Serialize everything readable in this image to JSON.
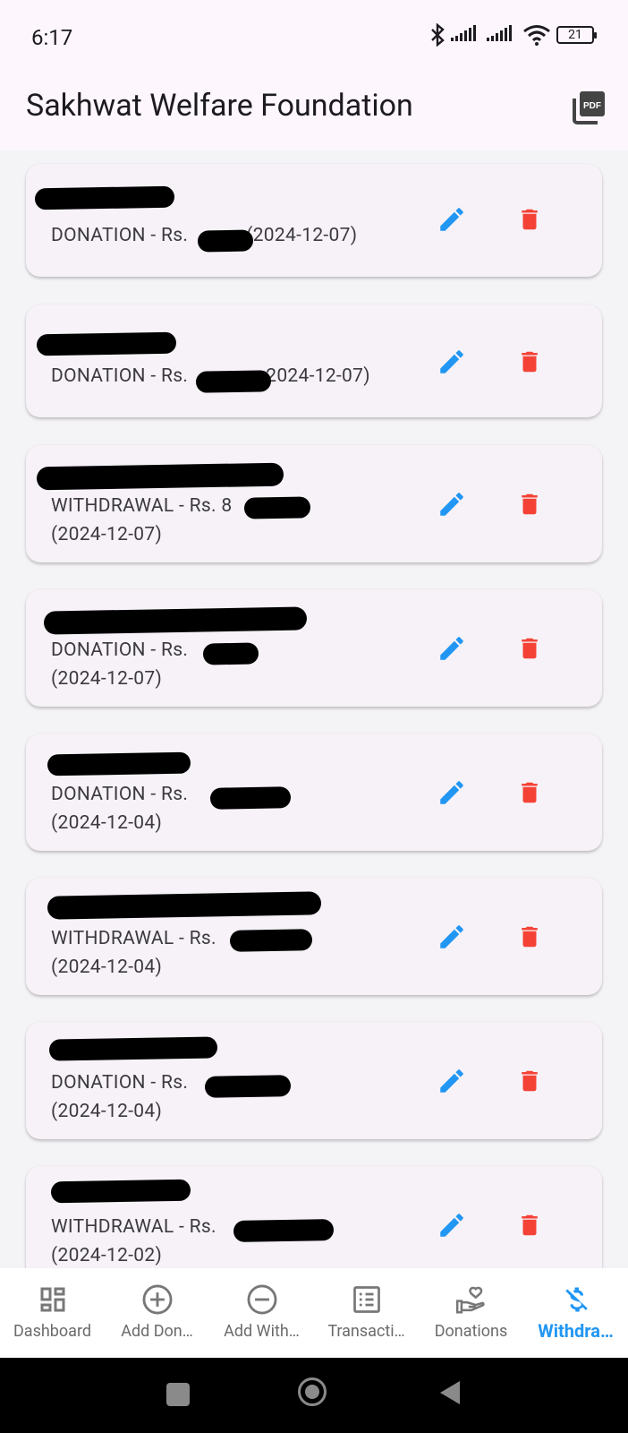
{
  "status": {
    "time": "6:17",
    "battery": "21"
  },
  "app_bar": {
    "title": "Sakhwat Welfare Foundation",
    "pdf_icon": "pdf-export-icon"
  },
  "colors": {
    "edit": "#2196f3",
    "delete": "#f44336",
    "active_tab": "#2196f3"
  },
  "transactions": [
    {
      "name": "",
      "line1": "DONATION - Rs.",
      "line2": "(2024-12-07)",
      "wrapped": false
    },
    {
      "name": "",
      "line1": "DONATION - Rs.",
      "line2": "2024-12-07)",
      "wrapped": false
    },
    {
      "name": "",
      "line1": "WITHDRAWAL - Rs. 8",
      "line2": "(2024-12-07)",
      "wrapped": true
    },
    {
      "name": "",
      "line1": "DONATION - Rs.",
      "line2": "(2024-12-07)",
      "wrapped": true
    },
    {
      "name": "",
      "line1": "DONATION - Rs.",
      "line2": "(2024-12-04)",
      "wrapped": true
    },
    {
      "name": "",
      "line1": "WITHDRAWAL - Rs.",
      "line2": "(2024-12-04)",
      "wrapped": true
    },
    {
      "name": "",
      "line1": "DONATION - Rs.",
      "line2": "(2024-12-04)",
      "wrapped": true
    },
    {
      "name": "",
      "line1": "WITHDRAWAL - Rs.",
      "line2": "(2024-12-02)",
      "wrapped": true
    }
  ],
  "bottom_nav": {
    "items": [
      {
        "label": "Dashboard",
        "icon": "dashboard-icon"
      },
      {
        "label": "Add Don…",
        "icon": "add-circle-icon"
      },
      {
        "label": "Add With…",
        "icon": "remove-circle-icon"
      },
      {
        "label": "Transacti…",
        "icon": "list-icon"
      },
      {
        "label": "Donations",
        "icon": "donation-hand-icon"
      },
      {
        "label": "Withdra…",
        "icon": "money-off-icon"
      }
    ],
    "active_index": 5
  }
}
